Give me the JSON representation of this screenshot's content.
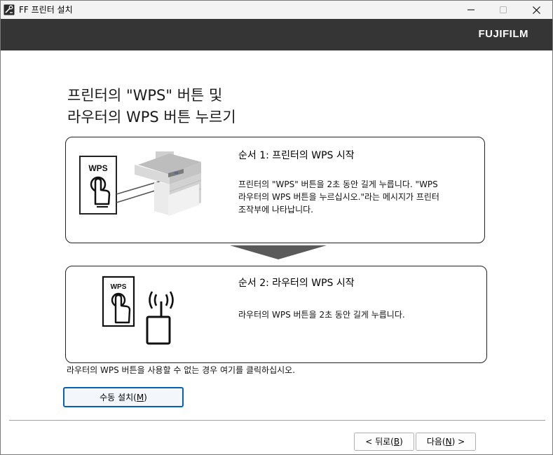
{
  "window": {
    "title": "FF 프린터 설치"
  },
  "brand": {
    "logo_text": "FUJIFILM"
  },
  "heading": {
    "line1": "프린터의 \"WPS\" 버튼 및",
    "line2": "라우터의 WPS 버튼 누르기"
  },
  "step1": {
    "title": "순서 1: 프린터의 WPS 시작",
    "description": "프린터의 \"WPS\" 버튼을 2초 동안 길게 누릅니다. \"WPS\n라우터의 WPS 버튼을 누르십시오.\"라는 메시지가 프린터\n조작부에 나타납니다.",
    "icon_label": "WPS"
  },
  "step2": {
    "title": "순서 2: 라우터의 WPS 시작",
    "description": "라우터의 WPS 버튼을 2초 동안 길게 누릅니다.",
    "icon_label": "WPS"
  },
  "note": "라우터의 WPS 버튼을 사용할 수 없는 경우 여기를 클릭하십시오.",
  "buttons": {
    "manual_prefix": "수동 설치(",
    "manual_key": "M",
    "manual_suffix": ")",
    "back_prefix": "< 뒤로(",
    "back_key": "B",
    "back_suffix": ")",
    "next_prefix": "다음(",
    "next_key": "N",
    "next_suffix": ") >"
  },
  "colors": {
    "brand_bar": "#353535",
    "title_bar": "#f3f3f3",
    "focus_border": "#0a5fb4",
    "arrow": "#5a5a5a"
  },
  "icons": {
    "app": "wrench-printer-icon",
    "minimize": "minimize-icon",
    "maximize": "maximize-icon",
    "close": "close-icon"
  }
}
